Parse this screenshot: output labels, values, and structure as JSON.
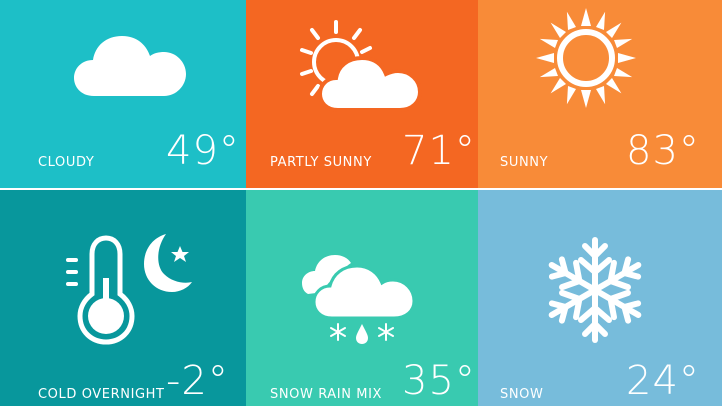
{
  "tiles": [
    {
      "label": "CLOUDY",
      "temp": "49°",
      "icon": "cloud-icon",
      "color": "#1DBFC7"
    },
    {
      "label": "PARTLY SUNNY",
      "temp": "71°",
      "icon": "partly-sunny-icon",
      "color": "#F46722"
    },
    {
      "label": "SUNNY",
      "temp": "83°",
      "icon": "sun-icon",
      "color": "#F88B38"
    },
    {
      "label": "COLD OVERNIGHT",
      "temp": "-2°",
      "icon": "thermometer-moon-icon",
      "color": "#08979C"
    },
    {
      "label": "SNOW RAIN MIX",
      "temp": "35°",
      "icon": "snow-rain-cloud-icon",
      "color": "#39CAB0"
    },
    {
      "label": "SNOW",
      "temp": "24°",
      "icon": "snowflake-icon",
      "color": "#77BCDB"
    }
  ]
}
